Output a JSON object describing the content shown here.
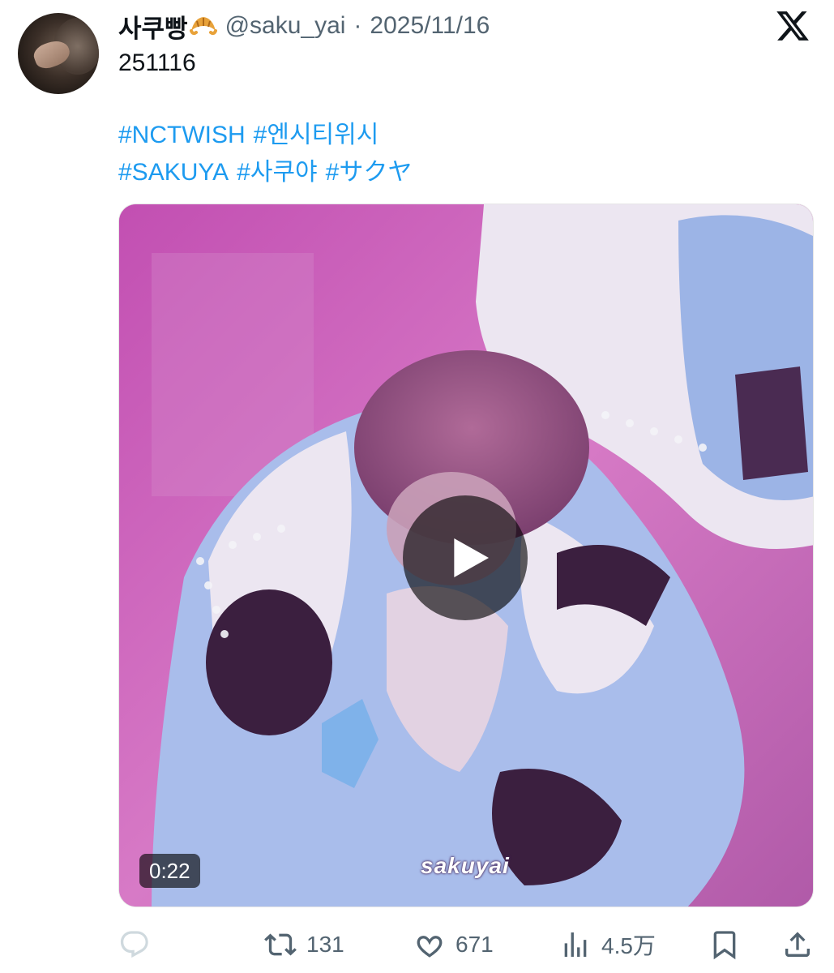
{
  "post": {
    "display_name": "사쿠빵",
    "handle": "@saku_yai",
    "separator": "·",
    "date": "2025/11/16",
    "text": "251116",
    "hashtags_row1": [
      "#NCTWISH",
      "#엔시티위시"
    ],
    "hashtags_row2": [
      "#SAKUYA",
      "#사쿠야",
      "#サクヤ"
    ]
  },
  "media": {
    "type": "video",
    "duration": "0:22",
    "watermark": "sakuyai"
  },
  "actions": {
    "reply": {
      "icon": "reply-icon",
      "count": ""
    },
    "repost": {
      "icon": "repost-icon",
      "count": "131"
    },
    "like": {
      "icon": "heart-icon",
      "count": "671"
    },
    "views": {
      "icon": "views-icon",
      "count": "4.5万"
    },
    "bookmark": {
      "icon": "bookmark-icon"
    },
    "share": {
      "icon": "share-icon"
    }
  },
  "colors": {
    "link": "#1d9bf0",
    "secondary_text": "#536471",
    "primary_text": "#0f1419",
    "icon_inactive_reply": "#cfd9de"
  },
  "brand": {
    "logo": "x-logo"
  }
}
